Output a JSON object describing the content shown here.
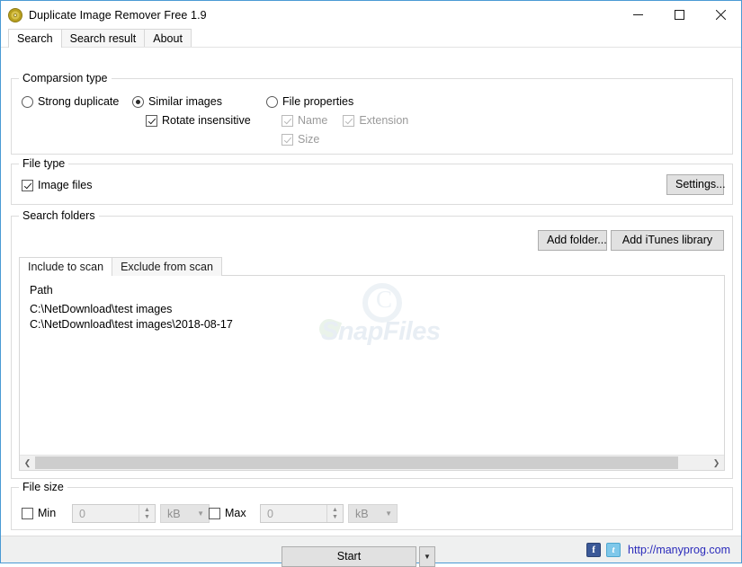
{
  "window": {
    "title": "Duplicate Image Remover Free 1.9",
    "icon": "disc-icon",
    "controls": {
      "minimize": "minimize-icon",
      "maximize": "maximize-icon",
      "close": "close-icon"
    }
  },
  "tabs": [
    {
      "label": "Search",
      "active": true
    },
    {
      "label": "Search result",
      "active": false
    },
    {
      "label": "About",
      "active": false
    }
  ],
  "comparison": {
    "legend": "Comparsion type",
    "strong_duplicate": {
      "label": "Strong duplicate",
      "checked": false
    },
    "similar_images": {
      "label": "Similar images",
      "checked": true
    },
    "rotate_insensitive": {
      "label": "Rotate insensitive",
      "checked": true
    },
    "file_properties": {
      "label": "File properties",
      "checked": false
    },
    "name": {
      "label": "Name",
      "checked": true,
      "disabled": true
    },
    "extension": {
      "label": "Extension",
      "checked": true,
      "disabled": true
    },
    "size": {
      "label": "Size",
      "checked": true,
      "disabled": true
    }
  },
  "file_type": {
    "legend": "File type",
    "image_files": {
      "label": "Image files",
      "checked": true
    },
    "settings_button": "Settings..."
  },
  "search_folders": {
    "legend": "Search folders",
    "add_folder_button": "Add folder...",
    "add_itunes_button": "Add iTunes library",
    "inner_tabs": [
      {
        "label": "Include to scan",
        "active": true
      },
      {
        "label": "Exclude from scan",
        "active": false
      }
    ],
    "column_header": "Path",
    "paths": [
      "C:\\NetDownload\\test images",
      "C:\\NetDownload\\test images\\2018-08-17"
    ],
    "scrollbar": {
      "left_arrow": "chevron-left-icon",
      "right_arrow": "chevron-right-icon"
    },
    "watermark": "SnapFiles"
  },
  "file_size": {
    "legend": "File size",
    "min": {
      "label": "Min",
      "checked": false,
      "value": "0",
      "unit": "kB"
    },
    "max": {
      "label": "Max",
      "checked": false,
      "value": "0",
      "unit": "kB"
    }
  },
  "actions": {
    "start_button": "Start",
    "start_dropdown": "chevron-down-icon"
  },
  "footer": {
    "facebook_icon": "facebook-icon",
    "facebook_glyph": "f",
    "twitter_icon": "twitter-icon",
    "twitter_glyph": "t",
    "url": "http://manyprog.com"
  },
  "colors": {
    "window_border": "#4a9ad4",
    "button_face": "#e1e1e1",
    "link": "#2b2bbb",
    "footer_bg": "#eff0f0"
  }
}
